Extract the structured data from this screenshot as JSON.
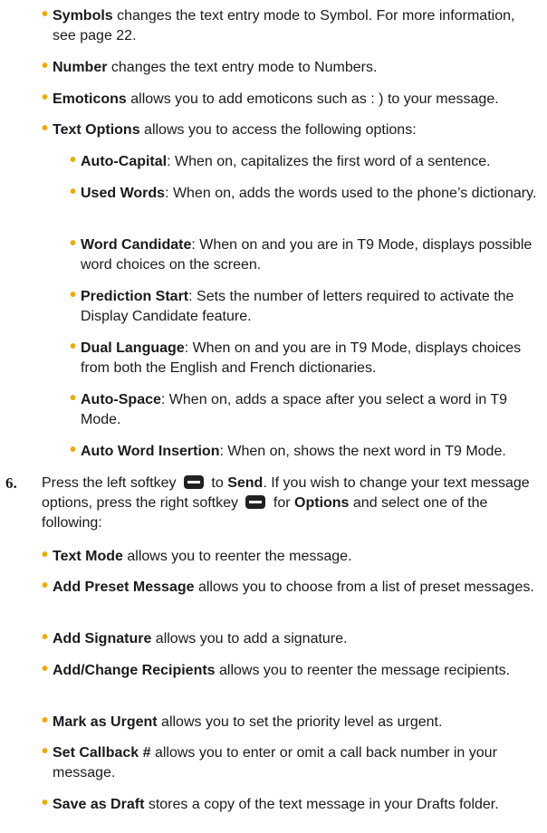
{
  "level1": [
    {
      "term": "Symbols",
      "text": " changes the text entry mode to Symbol. For more information, see page 22."
    },
    {
      "term": "Number",
      "text": " changes the text entry mode to Numbers."
    },
    {
      "term": "Emoticons",
      "text": " allows you to add emoticons such as : ) to your message."
    },
    {
      "term": "Text Options",
      "text": " allows you to access the following options:"
    }
  ],
  "level2": [
    {
      "term": "Auto-Capital",
      "text": ": When on, capitalizes the first word of a sentence."
    },
    {
      "term": "Used Words",
      "text": ": When on, adds the words used to the phone’s dictionary."
    },
    {
      "term": "Word Candidate",
      "text": ": When on and you are in T9 Mode, displays possible word choices on the screen."
    },
    {
      "term": "Prediction Start",
      "text": ": Sets the number of letters required to activate the Display Candidate feature."
    },
    {
      "term": "Dual Language",
      "text": ": When on and you are in T9 Mode, displays choices from both the English and French dictionaries."
    },
    {
      "term": "Auto-Space",
      "text": ": When on, adds a space after you select a word in T9 Mode."
    },
    {
      "term": "Auto Word Insertion",
      "text": ": When on, shows the next word in T9 Mode."
    }
  ],
  "step6": {
    "number": "6.",
    "t1": "Press the left softkey",
    "t2": " to ",
    "send": "Send",
    "t3": ". If you wish to change your text message options, press the right softkey",
    "t4": " for ",
    "options": "Options",
    "t5": " and select one of the following:"
  },
  "level3": [
    {
      "term": "Text Mode",
      "text": " allows you to reenter the message."
    },
    {
      "term": "Add Preset Message",
      "text": " allows you to choose from a list of preset messages."
    },
    {
      "term": "Add Signature",
      "text": " allows you to add a signature."
    },
    {
      "term": "Add/Change Recipients",
      "text": " allows you to reenter the message recipients."
    },
    {
      "term": "Mark as Urgent",
      "text": " allows you to set the priority level as urgent."
    },
    {
      "term": "Set Callback #",
      "text": " allows you to enter or omit a call back number in your message."
    },
    {
      "term": "Save as Draft",
      "text": " stores a copy of the text message in your Drafts folder."
    }
  ]
}
